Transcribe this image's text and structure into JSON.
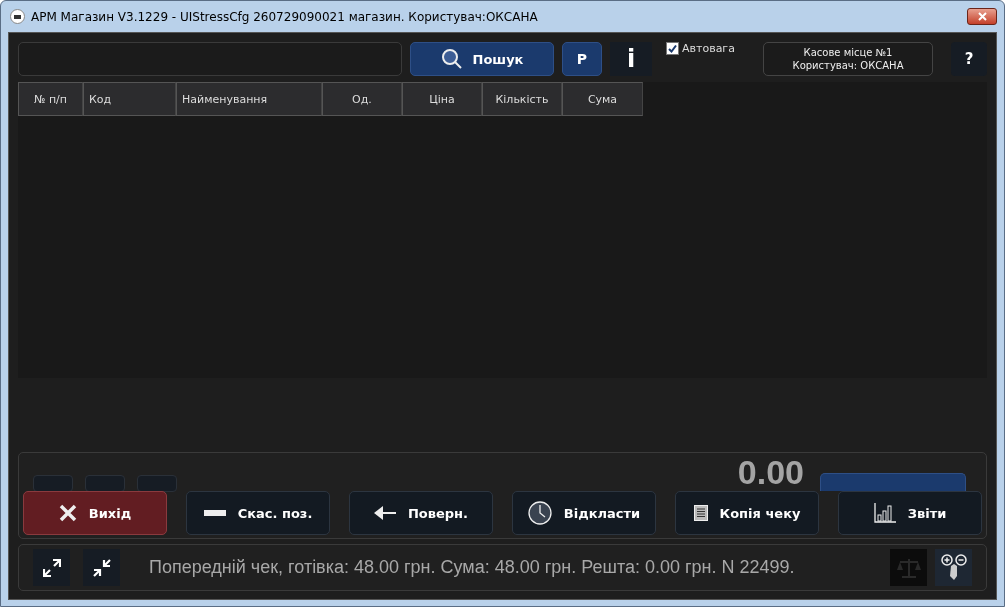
{
  "window": {
    "title": "АРМ Магазин V3.1229 - UIStressCfg 260729090021 магазин. Користувач:ОКСАНА"
  },
  "toolbar": {
    "search_button": "Пошук",
    "p_button": "P",
    "info_button": "i",
    "autoweight": {
      "label": "Автовага",
      "checked": true
    },
    "cash_desk": {
      "line_1": "Касове місце №1",
      "line_2": "Користувач: ОКСАНА"
    },
    "help_button": "?"
  },
  "table": {
    "columns": [
      "№ п/п",
      "Код",
      "Найменування",
      "Од.",
      "Ціна",
      "Кількість",
      "Сума"
    ]
  },
  "total": "0.00",
  "actions": [
    {
      "label": "Вихід",
      "kind": "exit"
    },
    {
      "label": "Скас. поз.",
      "kind": "cancel"
    },
    {
      "label": "Поверн.",
      "kind": "return"
    },
    {
      "label": "Відкласти",
      "kind": "postpone"
    },
    {
      "label": "Копія чеку",
      "kind": "copy"
    },
    {
      "label": "Звіти",
      "kind": "reports"
    }
  ],
  "status_bar": {
    "text": "Попередній чек, готівка: 48.00 грн. Сума: 48.00 грн. Решта: 0.00 грн. N 22499."
  }
}
